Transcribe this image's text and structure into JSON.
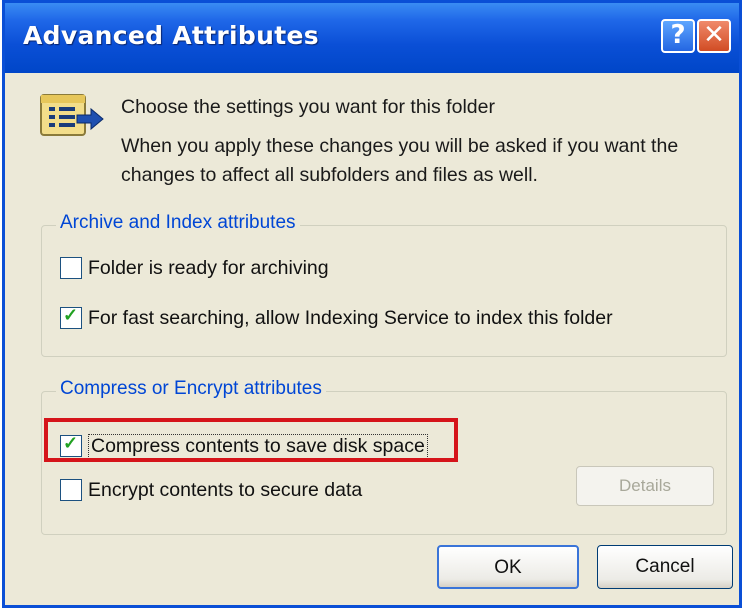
{
  "window": {
    "title": "Advanced Attributes",
    "help_label": "?",
    "close_label": "✕"
  },
  "intro": {
    "icon": "folder-properties-icon",
    "line1": "Choose the settings you want for this folder",
    "line2": "When you apply these changes you will be asked if you want the changes to affect all subfolders and files as well."
  },
  "archive_group": {
    "label": "Archive and Index attributes",
    "items": [
      {
        "label": "Folder is ready for archiving",
        "checked": false
      },
      {
        "label": "For fast searching, allow Indexing Service to index this folder",
        "checked": true
      }
    ]
  },
  "compress_group": {
    "label": "Compress or Encrypt attributes",
    "items": [
      {
        "label": "Compress contents to save disk space",
        "checked": true
      },
      {
        "label": "Encrypt contents to secure data",
        "checked": false
      }
    ],
    "details_label": "Details"
  },
  "buttons": {
    "ok": "OK",
    "cancel": "Cancel"
  },
  "colors": {
    "title_bar": "#0a4fd6",
    "group_label": "#0046d5",
    "highlight": "#d5141a",
    "checkmark": "#21a121"
  }
}
